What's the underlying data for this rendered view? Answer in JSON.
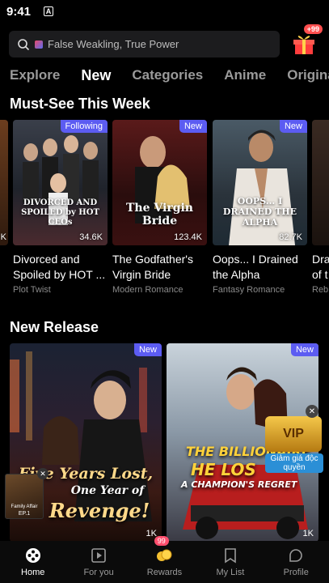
{
  "status_bar": {
    "time": "9:41",
    "notif_icon": "A"
  },
  "search": {
    "placeholder": "False Weakling, True Power"
  },
  "gift": {
    "badge": "+99"
  },
  "tabs": [
    "Explore",
    "New",
    "Categories",
    "Anime",
    "Origina"
  ],
  "active_tab": "New",
  "sections": {
    "must_see": "Must-See This Week",
    "new_release": "New Release"
  },
  "must_see_cards": [
    {
      "poster_text": "DIVORCED AND SPOILED by HOT CEOs",
      "badge": "Following",
      "views": "34.6K",
      "title": "Divorced and Spoiled by HOT ...",
      "genre": "Plot Twist"
    },
    {
      "poster_text": "The Virgin Bride",
      "badge": "New",
      "views": "123.4K",
      "title": "The Godfather's Virgin Bride",
      "genre": "Modern Romance"
    },
    {
      "poster_text": "OOPS... I DRAINED THE ALPHA",
      "badge": "New",
      "views": "82.7K",
      "title": "Oops... I Drained the Alpha",
      "genre": "Fantasy Romance"
    },
    {
      "title": "Dra of t",
      "genre": "Reb"
    }
  ],
  "left_edge_card": {
    "views_partial": "K"
  },
  "new_release_cards": [
    {
      "poster_line1": "Five Years Lost,",
      "poster_line2": "One Year of",
      "poster_line3": "Revenge!",
      "badge": "New",
      "views": "1K"
    },
    {
      "poster_line1": "THE BILLIONAIRE",
      "poster_line2": "HE LOS",
      "poster_line3": "A CHAMPION'S REGRET",
      "badge": "New",
      "views": "1K"
    }
  ],
  "mini_player": {
    "label": "Family Affair",
    "episode": "EP.1"
  },
  "vip_promo": {
    "label": "VIP",
    "caption": "Giảm giá độc quyền"
  },
  "bottom_nav": [
    {
      "label": "Home",
      "icon": "home-film-reel-icon",
      "active": true
    },
    {
      "label": "For you",
      "icon": "play-card-icon",
      "active": false
    },
    {
      "label": "Rewards",
      "icon": "coins-icon",
      "active": false,
      "badge": "99"
    },
    {
      "label": "My List",
      "icon": "bookmark-icon",
      "active": false
    },
    {
      "label": "Profile",
      "icon": "profile-icon",
      "active": false
    }
  ],
  "colors": {
    "accent_badge": "#5c5cf2",
    "background": "#000000",
    "badge_red": "#ff4f4f"
  }
}
